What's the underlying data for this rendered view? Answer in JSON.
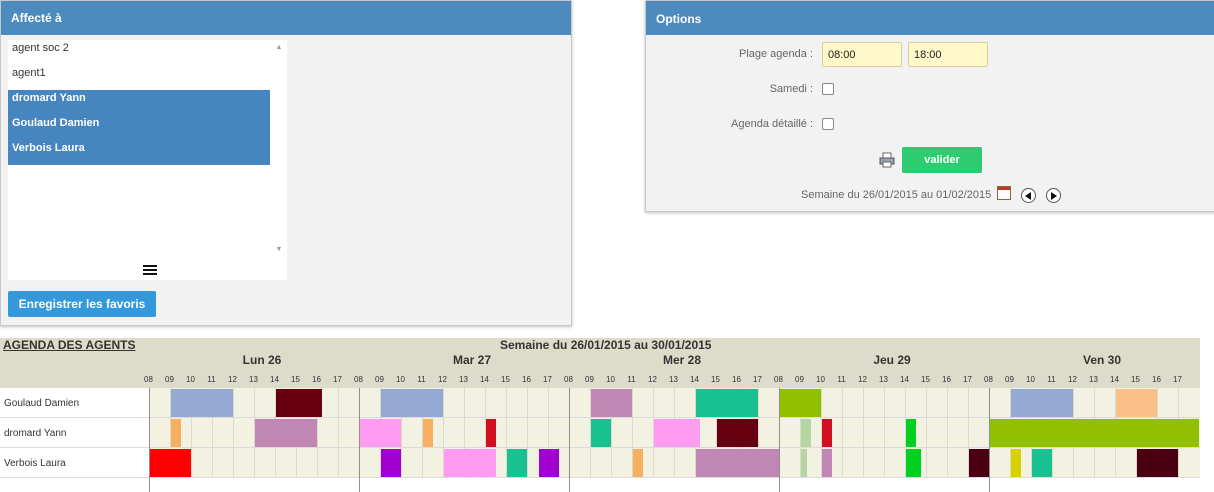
{
  "assign": {
    "title": "Affecté à",
    "items": [
      {
        "label": "agent soc 2",
        "selected": false
      },
      {
        "label": "agent1",
        "selected": false
      },
      {
        "label": "dromard Yann",
        "selected": true
      },
      {
        "label": "Goulaud Damien",
        "selected": true
      },
      {
        "label": "Verbois Laura",
        "selected": true
      }
    ],
    "save_label": "Enregistrer les favoris",
    "list_icon": "list-icon"
  },
  "options": {
    "title": "Options",
    "range_label": "Plage agenda :",
    "start": "08:00",
    "end": "18:00",
    "saturday_label": "Samedi :",
    "saturday_checked": false,
    "detailed_label": "Agenda détaillé :",
    "detailed_checked": false,
    "validate_label": "valider",
    "week_text": "Semaine du 26/01/2015 au 01/02/2015",
    "print_icon": "printer-icon",
    "calendar_icon": "calendar-icon",
    "prev_icon": "arrow-left-circle-icon",
    "next_icon": "arrow-right-circle-icon"
  },
  "agenda": {
    "title": "AGENDA DES AGENTS",
    "week": "Semaine du 26/01/2015 au 30/01/2015",
    "days": [
      "Lun 26",
      "Mar 27",
      "Mer 28",
      "Jeu 29",
      "Ven 30"
    ],
    "hours": [
      "08",
      "09",
      "10",
      "11",
      "12",
      "13",
      "14",
      "15",
      "16",
      "17"
    ],
    "rows": [
      {
        "name": "Goulaud Damien",
        "appointments": [
          {
            "day": 0,
            "start": 9,
            "end": 12,
            "color": "#94a9d4"
          },
          {
            "day": 0,
            "start": 14,
            "end": 16.25,
            "color": "#660011"
          },
          {
            "day": 1,
            "start": 9,
            "end": 12,
            "color": "#94a9d4"
          },
          {
            "day": 2,
            "start": 9,
            "end": 11,
            "color": "#c086b4"
          },
          {
            "day": 2,
            "start": 14,
            "end": 17,
            "color": "#19c090"
          },
          {
            "day": 3,
            "start": 8,
            "end": 10,
            "color": "#90c000"
          },
          {
            "day": 4,
            "start": 9,
            "end": 12,
            "color": "#94a9d4"
          },
          {
            "day": 4,
            "start": 14,
            "end": 16,
            "color": "#fbc088"
          }
        ]
      },
      {
        "name": "dromard Yann",
        "appointments": [
          {
            "day": 0,
            "start": 9,
            "end": 9.5,
            "color": "#f6b060"
          },
          {
            "day": 0,
            "start": 13,
            "end": 16,
            "color": "#c086b4"
          },
          {
            "day": 1,
            "start": 8,
            "end": 10,
            "color": "#ff9cf2"
          },
          {
            "day": 1,
            "start": 11,
            "end": 11.5,
            "color": "#f6b060"
          },
          {
            "day": 1,
            "start": 14,
            "end": 14.5,
            "color": "#d01020"
          },
          {
            "day": 2,
            "start": 9,
            "end": 10,
            "color": "#19c090"
          },
          {
            "day": 2,
            "start": 12,
            "end": 14.25,
            "color": "#ff9cf2"
          },
          {
            "day": 2,
            "start": 15,
            "end": 17,
            "color": "#660011"
          },
          {
            "day": 3,
            "start": 9,
            "end": 9.5,
            "color": "#b5d6a0"
          },
          {
            "day": 3,
            "start": 10,
            "end": 10.5,
            "color": "#d01020"
          },
          {
            "day": 3,
            "start": 14,
            "end": 14.5,
            "color": "#00d020"
          },
          {
            "day": 4,
            "start": 8,
            "end": 18,
            "color": "#90c000"
          }
        ]
      },
      {
        "name": "Verbois Laura",
        "appointments": [
          {
            "day": 0,
            "start": 8,
            "end": 10,
            "color": "#ff0000"
          },
          {
            "day": 1,
            "start": 9,
            "end": 10,
            "color": "#a000d0"
          },
          {
            "day": 1,
            "start": 12,
            "end": 14.5,
            "color": "#ff9cf2"
          },
          {
            "day": 1,
            "start": 15,
            "end": 16,
            "color": "#19c090"
          },
          {
            "day": 1,
            "start": 16.5,
            "end": 17.5,
            "color": "#a000d0"
          },
          {
            "day": 2,
            "start": 11,
            "end": 11.5,
            "color": "#f6b060"
          },
          {
            "day": 2,
            "start": 14,
            "end": 18,
            "color": "#c086b4"
          },
          {
            "day": 3,
            "start": 9,
            "end": 9.3,
            "color": "#b5d6a0"
          },
          {
            "day": 3,
            "start": 10,
            "end": 10.5,
            "color": "#c086b4"
          },
          {
            "day": 3,
            "start": 14,
            "end": 14.75,
            "color": "#00d020"
          },
          {
            "day": 3,
            "start": 17,
            "end": 18,
            "color": "#4a0010"
          },
          {
            "day": 4,
            "start": 9,
            "end": 9.5,
            "color": "#d8d000"
          },
          {
            "day": 4,
            "start": 10,
            "end": 11,
            "color": "#19c090"
          },
          {
            "day": 4,
            "start": 15,
            "end": 17,
            "color": "#4a0010"
          }
        ]
      }
    ]
  }
}
